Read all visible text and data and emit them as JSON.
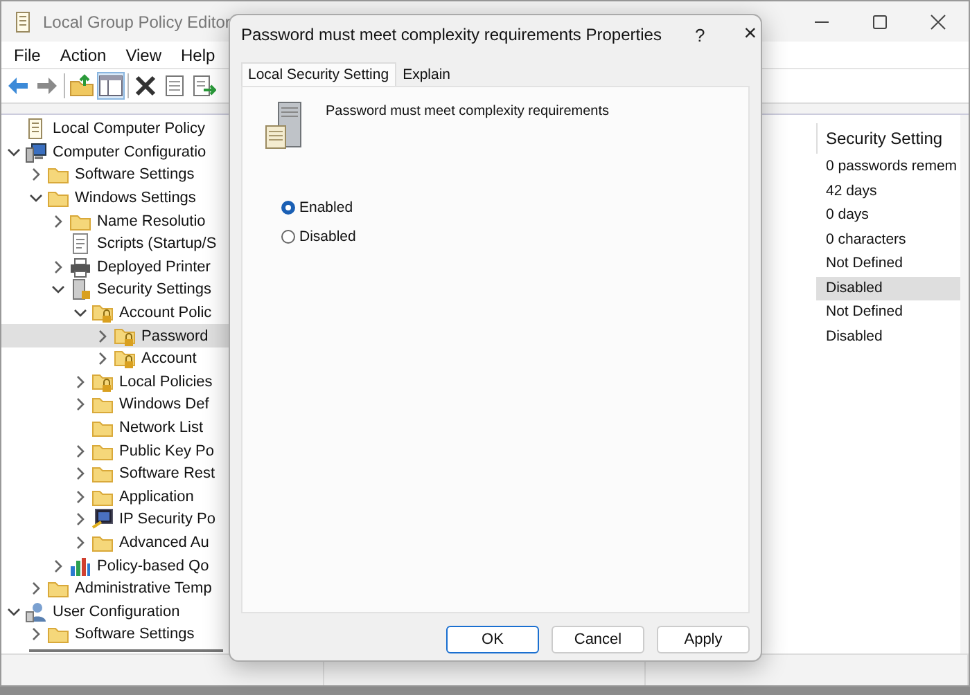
{
  "window": {
    "title": "Local Group Policy Editor"
  },
  "menu": [
    "File",
    "Action",
    "View",
    "Help"
  ],
  "toolbar": [
    {
      "kind": "back",
      "selected": false
    },
    {
      "kind": "forward",
      "selected": false
    },
    {
      "kind": "up",
      "selected": false
    },
    {
      "kind": "tree",
      "selected": true
    },
    {
      "kind": "delete",
      "selected": false
    },
    {
      "kind": "properties",
      "selected": false
    },
    {
      "kind": "export",
      "selected": false
    }
  ],
  "tree": [
    {
      "label": "Local Computer Policy",
      "kind": "document",
      "selected": false
    },
    {
      "label": "Computer Configuratio",
      "kind": "computer",
      "expanded": true,
      "selected": false,
      "children": [
        {
          "label": "Software Settings",
          "kind": "folder",
          "expanded": false,
          "selected": false
        },
        {
          "label": "Windows Settings",
          "kind": "folder",
          "expanded": true,
          "selected": false,
          "children": [
            {
              "label": "Name Resolutio",
              "kind": "folder",
              "expanded": false,
              "selected": false
            },
            {
              "label": "Scripts (Startup/S",
              "kind": "scripts",
              "selected": false
            },
            {
              "label": "Deployed Printer",
              "kind": "printer",
              "expanded": false,
              "selected": false
            },
            {
              "label": "Security Settings",
              "kind": "security",
              "expanded": true,
              "selected": false,
              "children": [
                {
                  "label": "Account Polic",
                  "kind": "lock-folder",
                  "expanded": true,
                  "selected": false,
                  "children": [
                    {
                      "label": "Password",
                      "kind": "lock-folder",
                      "expanded": false,
                      "selected": true
                    },
                    {
                      "label": "Account",
                      "kind": "lock-folder",
                      "expanded": false,
                      "selected": false
                    }
                  ]
                },
                {
                  "label": "Local Policies",
                  "kind": "lock-folder",
                  "expanded": false,
                  "selected": false
                },
                {
                  "label": "Windows Def",
                  "kind": "folder",
                  "expanded": false,
                  "selected": false
                },
                {
                  "label": "Network List",
                  "kind": "folder",
                  "selected": false
                },
                {
                  "label": "Public Key Po",
                  "kind": "folder",
                  "expanded": false,
                  "selected": false
                },
                {
                  "label": "Software Rest",
                  "kind": "folder",
                  "expanded": false,
                  "selected": false
                },
                {
                  "label": "Application",
                  "kind": "folder",
                  "expanded": false,
                  "selected": false
                },
                {
                  "label": "IP Security Po",
                  "kind": "ipsec",
                  "expanded": false,
                  "selected": false
                },
                {
                  "label": "Advanced Au",
                  "kind": "folder",
                  "expanded": false,
                  "selected": false
                }
              ]
            },
            {
              "label": "Policy-based Qo",
              "kind": "chart",
              "expanded": false,
              "selected": false
            }
          ]
        },
        {
          "label": "Administrative Temp",
          "kind": "folder",
          "expanded": false,
          "selected": false
        }
      ]
    },
    {
      "label": "User Configuration",
      "kind": "user",
      "expanded": true,
      "selected": false,
      "children": [
        {
          "label": "Software Settings",
          "kind": "folder",
          "expanded": false,
          "selected": false
        }
      ]
    }
  ],
  "settings_column": {
    "header": "Security Setting",
    "rows": [
      {
        "value": "0 passwords remem",
        "selected": false
      },
      {
        "value": "42 days",
        "selected": false
      },
      {
        "value": "0 days",
        "selected": false
      },
      {
        "value": "0 characters",
        "selected": false
      },
      {
        "value": "Not Defined",
        "selected": false
      },
      {
        "value": "Disabled",
        "selected": true
      },
      {
        "value": "Not Defined",
        "selected": false
      },
      {
        "value": "Disabled",
        "selected": false
      }
    ]
  },
  "dialog": {
    "title": "Password must meet complexity requirements Properties",
    "help": "?",
    "close": "×",
    "tabs": [
      {
        "label": "Local Security Setting",
        "selected": true
      },
      {
        "label": "Explain",
        "selected": false
      }
    ],
    "policy_name": "Password must meet complexity requirements",
    "options": [
      {
        "label": "Enabled",
        "selected": true
      },
      {
        "label": "Disabled",
        "selected": false
      }
    ],
    "buttons": [
      {
        "label": "OK",
        "default": true
      },
      {
        "label": "Cancel",
        "default": false
      },
      {
        "label": "Apply",
        "default": false
      }
    ]
  }
}
